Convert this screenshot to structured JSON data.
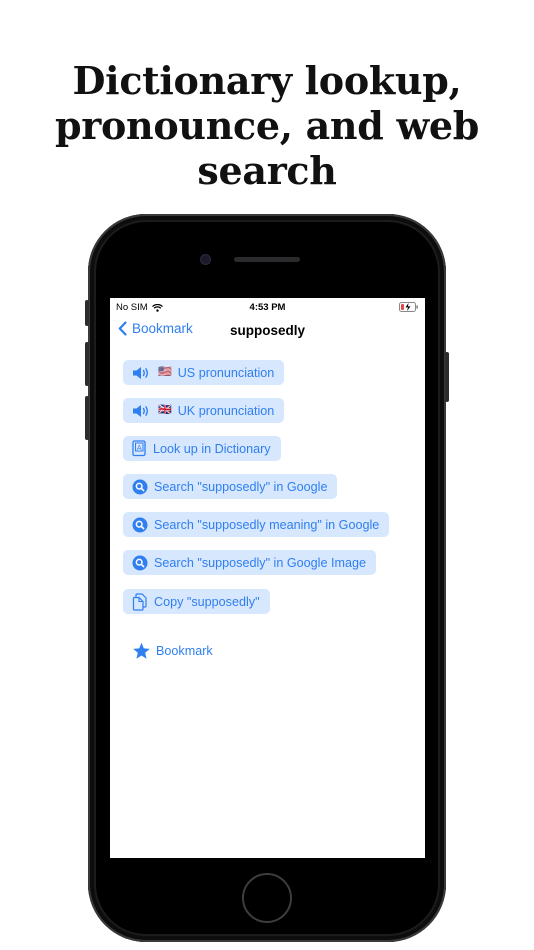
{
  "headline": {
    "line1": "Dictionary lookup,",
    "line2": "pronounce, and web",
    "line3": "search"
  },
  "status_bar": {
    "carrier": "No SIM",
    "time": "4:53 PM"
  },
  "nav": {
    "back_label": "Bookmark",
    "title": "supposedly"
  },
  "actions": {
    "us_flag": "🇺🇸",
    "us_label": "US pronunciation",
    "uk_flag": "🇬🇧",
    "uk_label": "UK pronunciation",
    "dictionary_label": "Look up in Dictionary",
    "google_label": "Search \"supposedly\" in Google",
    "google_meaning_label": "Search \"supposedly meaning\" in Google",
    "google_image_label": "Search \"supposedly\" in Google Image",
    "copy_label": "Copy \"supposedly\""
  },
  "bookmark": {
    "label": "Bookmark"
  },
  "colors": {
    "accent": "#2f7ff0",
    "button_bg": "#d7e7fd",
    "battery_low": "#e5484d"
  },
  "icons": {
    "speaker": "speaker-wave-icon",
    "dictionary": "dictionary-book-icon",
    "search": "magnifier-circle-icon",
    "copy": "doc-on-doc-icon",
    "star": "star-fill-icon",
    "back": "chevron-left-icon",
    "wifi": "wifi-icon",
    "battery": "battery-charging-icon"
  }
}
